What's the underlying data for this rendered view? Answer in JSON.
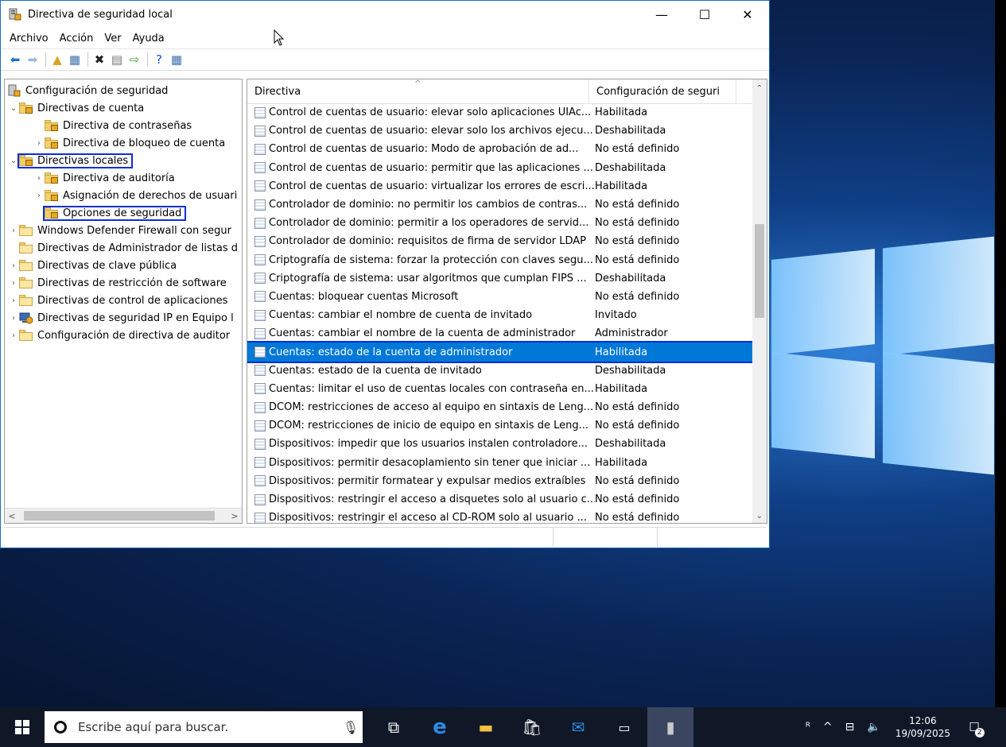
{
  "window": {
    "title": "Directiva de seguridad local",
    "controls": {
      "minimize": "—",
      "maximize": "☐",
      "close": "✕"
    }
  },
  "menu": [
    "Archivo",
    "Acción",
    "Ver",
    "Ayuda"
  ],
  "toolbar_icons": [
    "back-icon",
    "forward-icon",
    "up-folder-icon",
    "show-hide-tree-icon",
    "delete-icon",
    "properties-icon",
    "export-icon",
    "help-icon",
    "view-icon"
  ],
  "tree": {
    "items": [
      {
        "label": "Configuración de seguridad",
        "level": 0,
        "expander": ""
      },
      {
        "label": "Directivas de cuenta",
        "level": 1,
        "expander": "⌄"
      },
      {
        "label": "Directiva de contraseñas",
        "level": 2,
        "expander": ""
      },
      {
        "label": "Directiva de bloqueo de cuenta",
        "level": 2,
        "expander": "›"
      },
      {
        "label": "Directivas locales",
        "level": 1,
        "expander": "⌄"
      },
      {
        "label": "Directiva de auditoría",
        "level": 2,
        "expander": "›"
      },
      {
        "label": "Asignación de derechos de usuari",
        "level": 2,
        "expander": "›"
      },
      {
        "label": "Opciones de seguridad",
        "level": 2,
        "expander": ""
      },
      {
        "label": "Windows Defender Firewall con segur",
        "level": 1,
        "expander": "›"
      },
      {
        "label": "Directivas de Administrador de listas d",
        "level": 1,
        "expander": ""
      },
      {
        "label": "Directivas de clave pública",
        "level": 1,
        "expander": "›"
      },
      {
        "label": "Directivas de restricción de software",
        "level": 1,
        "expander": "›"
      },
      {
        "label": "Directivas de control de aplicaciones",
        "level": 1,
        "expander": "›"
      },
      {
        "label": "Directivas de seguridad IP en Equipo l",
        "level": 1,
        "expander": "›"
      },
      {
        "label": "Configuración de directiva de auditor",
        "level": 1,
        "expander": "›"
      }
    ]
  },
  "list": {
    "headers": {
      "policy": "Directiva",
      "setting": "Configuración de seguri"
    },
    "rows": [
      {
        "name": "Control de cuentas de usuario: elevar solo aplicaciones UIAc...",
        "value": "Habilitada"
      },
      {
        "name": "Control de cuentas de usuario: elevar solo los archivos ejecu...",
        "value": "Deshabilitada"
      },
      {
        "name": "Control de cuentas de usuario: Modo de aprobación de ad...",
        "value": "No está definido"
      },
      {
        "name": "Control de cuentas de usuario: permitir que las aplicaciones ...",
        "value": "Deshabilitada"
      },
      {
        "name": "Control de cuentas de usuario: virtualizar los errores de escri...",
        "value": "Habilitada"
      },
      {
        "name": "Controlador de dominio: no permitir los cambios de contras...",
        "value": "No está definido"
      },
      {
        "name": "Controlador de dominio: permitir a los operadores de servid...",
        "value": "No está definido"
      },
      {
        "name": "Controlador de dominio: requisitos de firma de servidor LDAP",
        "value": "No está definido"
      },
      {
        "name": "Criptografía de sistema: forzar la protección con claves segu...",
        "value": "No está definido"
      },
      {
        "name": "Criptografía de sistema: usar algoritmos que cumplan FIPS ...",
        "value": "Deshabilitada"
      },
      {
        "name": "Cuentas: bloquear cuentas Microsoft",
        "value": "No está definido"
      },
      {
        "name": "Cuentas: cambiar el nombre de cuenta de invitado",
        "value": "Invitado"
      },
      {
        "name": "Cuentas: cambiar el nombre de la cuenta de administrador",
        "value": "Administrador"
      },
      {
        "name": "Cuentas: estado de la cuenta de administrador",
        "value": "Habilitada",
        "selected": true
      },
      {
        "name": "Cuentas: estado de la cuenta de invitado",
        "value": "Deshabilitada"
      },
      {
        "name": "Cuentas: limitar el uso de cuentas locales con contraseña en...",
        "value": "Habilitada"
      },
      {
        "name": "DCOM: restricciones de acceso al equipo en sintaxis de Leng...",
        "value": "No está definido"
      },
      {
        "name": "DCOM: restricciones de inicio de equipo en sintaxis de Leng...",
        "value": "No está definido"
      },
      {
        "name": "Dispositivos: impedir que los usuarios instalen controladore...",
        "value": "Deshabilitada"
      },
      {
        "name": "Dispositivos: permitir desacoplamiento sin tener que iniciar ...",
        "value": "Habilitada"
      },
      {
        "name": "Dispositivos: permitir formatear y expulsar medios extraíbles",
        "value": "No está definido"
      },
      {
        "name": "Dispositivos: restringir el acceso a disquetes solo al usuario c...",
        "value": "No está definido"
      },
      {
        "name": "Dispositivos: restringir el acceso al CD-ROM solo al usuario ...",
        "value": "No está definido"
      }
    ]
  },
  "taskbar": {
    "search_placeholder": "Escribe aquí para buscar.",
    "apps": [
      "task-view-icon",
      "edge-icon",
      "file-explorer-icon",
      "store-icon",
      "mail-icon",
      "cmd-icon",
      "security-policy-icon"
    ],
    "clock_time": "12:06",
    "clock_date": "19/09/2025",
    "notification_count": "2"
  }
}
